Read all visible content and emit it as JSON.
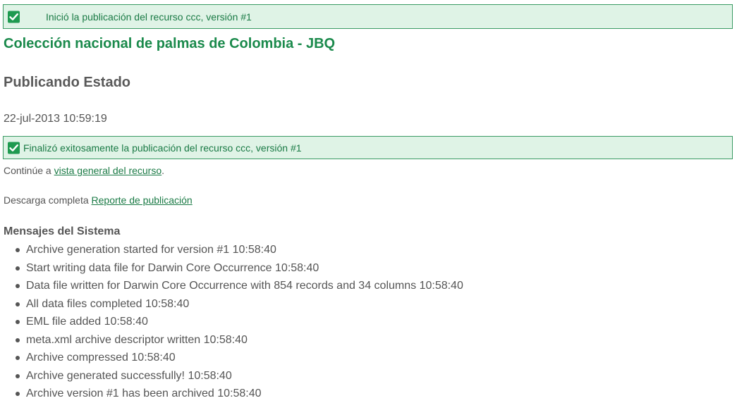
{
  "top_message": {
    "text": "Inició la publicación del recurso ccc, versión #1",
    "icon": "check-icon",
    "accent_color": "#1f9a50"
  },
  "resource_title": "Colección nacional de palmas de Colombia - JBQ",
  "status_heading": "Publicando Estado",
  "timestamp": "22-jul-2013 10:59:19",
  "success_message": {
    "text": "Finalizó exitosamente la publicación del recurso ccc, versión #1",
    "icon": "check-icon"
  },
  "continue": {
    "prefix": "Continúe a ",
    "link": "vista general del recurso",
    "suffix": "."
  },
  "download": {
    "prefix": "Descarga completa ",
    "link": "Reporte de publicación"
  },
  "system_messages": {
    "heading": "Mensajes del Sistema",
    "items": [
      "Archive generation started for version #1 10:58:40",
      "Start writing data file for Darwin Core Occurrence 10:58:40",
      "Data file written for Darwin Core Occurrence with 854 records and 34 columns 10:58:40",
      "All data files completed 10:58:40",
      "EML file added 10:58:40",
      "meta.xml archive descriptor written 10:58:40",
      "Archive compressed 10:58:40",
      "Archive generated successfully! 10:58:40",
      "Archive version #1 has been archived 10:58:40"
    ]
  }
}
